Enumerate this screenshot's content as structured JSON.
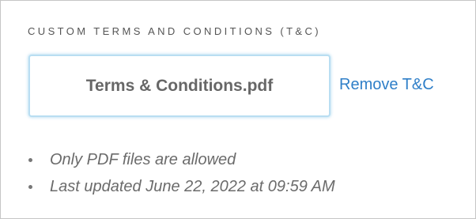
{
  "section": {
    "heading": "CUSTOM TERMS AND CONDITIONS (T&C)"
  },
  "file": {
    "name": "Terms & Conditions.pdf",
    "remove_label": "Remove T&C"
  },
  "notes": [
    "Only PDF files are allowed",
    "Last updated June 22, 2022 at 09:59 AM"
  ],
  "colors": {
    "link": "#2f7fc8",
    "box_border": "#b9def2",
    "text_muted": "#6b6b6b"
  }
}
